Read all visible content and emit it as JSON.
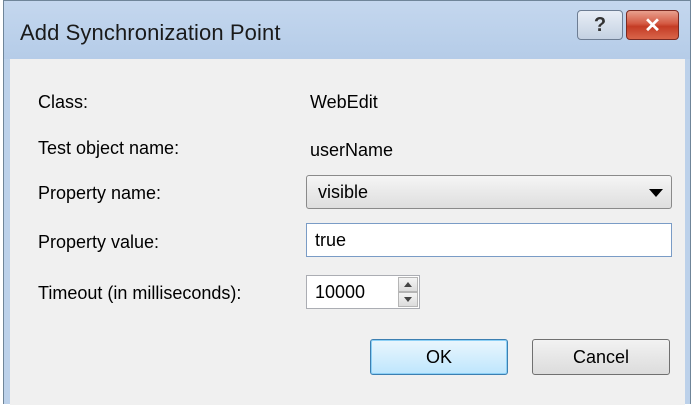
{
  "window": {
    "title": "Add Synchronization Point",
    "help_glyph": "?",
    "close_glyph": "✕"
  },
  "form": {
    "class_label": "Class:",
    "class_value": "WebEdit",
    "test_object_label": "Test object name:",
    "test_object_value": "userName",
    "property_name_label": "Property name:",
    "property_name_value": "visible",
    "property_value_label": "Property value:",
    "property_value_value": "true",
    "timeout_label": "Timeout (in milliseconds):",
    "timeout_value": "10000"
  },
  "buttons": {
    "ok_label": "OK",
    "cancel_label": "Cancel"
  },
  "icons": {
    "help": "help-icon",
    "close": "close-icon",
    "dropdown": "chevron-down-icon",
    "spin_up": "spin-up-icon",
    "spin_down": "spin-down-icon"
  },
  "colors": {
    "titlebar": "#bcd1ea",
    "close_button": "#c43c25",
    "default_button": "#bee6fd",
    "dialog_background": "#f0f0f0"
  }
}
